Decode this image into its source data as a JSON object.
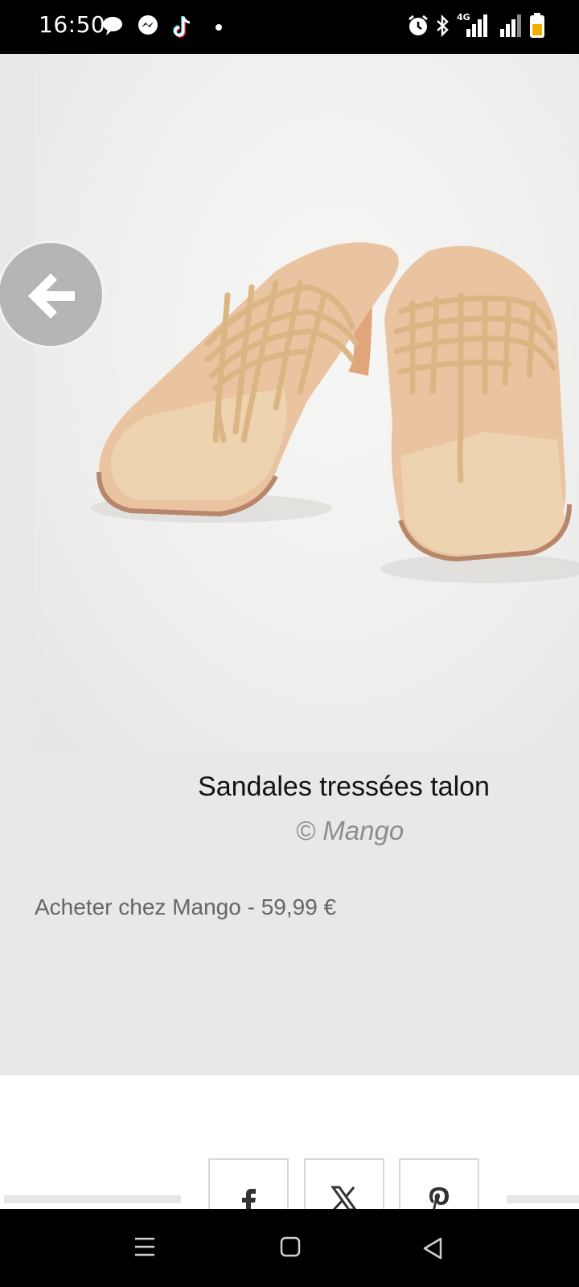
{
  "status_bar": {
    "time": "16:50",
    "icons_left": [
      "chat-bubble-icon",
      "messenger-icon",
      "tiktok-icon",
      "dot-icon"
    ],
    "icons_right": [
      "alarm-icon",
      "bluetooth-icon",
      "signal-4g-icon",
      "signal-icon",
      "battery-icon"
    ],
    "network_label": "4G"
  },
  "gallery": {
    "image_subject": "product-photo",
    "caption_title": "Sandales tressées talon",
    "caption_credit": "© Mango",
    "buy_link": "Acheter chez Mango - 59,99 €"
  },
  "share": {
    "buttons": [
      {
        "name": "facebook",
        "glyph": "f"
      },
      {
        "name": "x",
        "glyph": "X"
      },
      {
        "name": "pinterest",
        "glyph": "P"
      }
    ]
  },
  "nav_bar": {
    "buttons": [
      "menu-icon",
      "home-square-icon",
      "back-triangle-icon"
    ]
  },
  "colors": {
    "gallery_bg": "#e8e8e8",
    "sandal": "#e9cfa8",
    "sole": "#e8a787"
  }
}
